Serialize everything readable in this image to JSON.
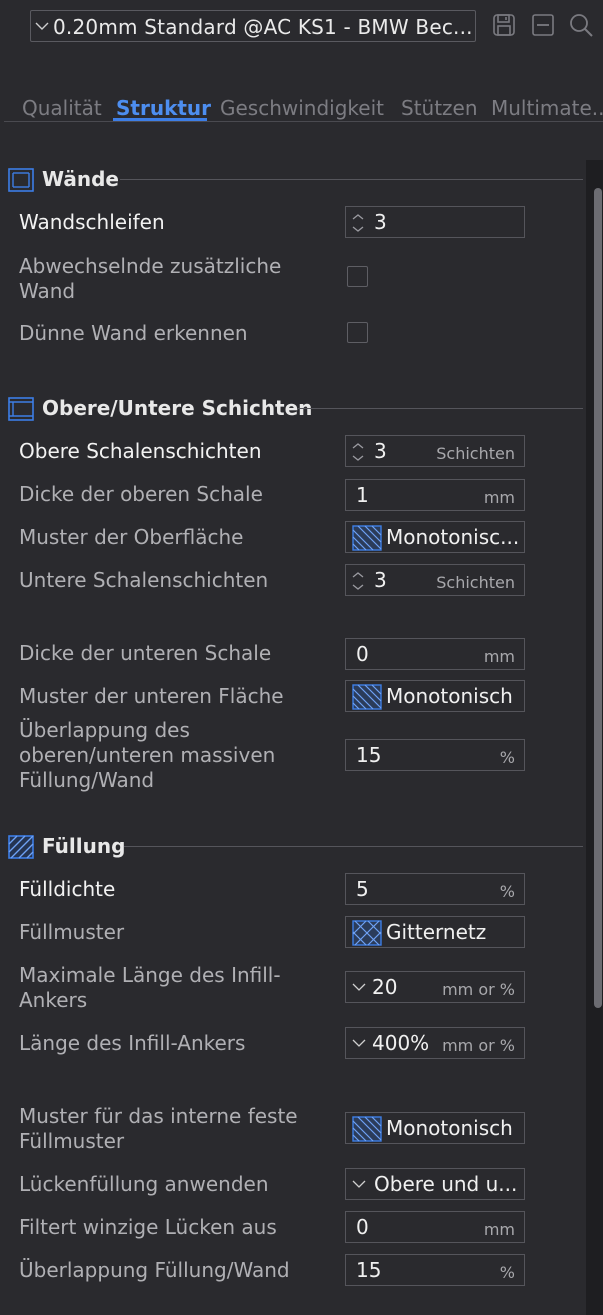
{
  "topbar": {
    "preset_label": "0.20mm Standard @AC KS1 - BMW Bec...",
    "icons": [
      "save-icon",
      "minus-box-icon",
      "search-icon"
    ]
  },
  "tabs": [
    "Qualität",
    "Struktur",
    "Geschwindigkeit",
    "Stützen",
    "Multimate.."
  ],
  "active_tab": "Struktur",
  "accent_color": "#3d7ee6",
  "sections": {
    "walls": {
      "title": "Wände",
      "rows": {
        "wall_loops": {
          "label": "Wandschleifen",
          "value": "3"
        },
        "alt_extra_wall": {
          "label": "Abwechselnde zusätzliche Wand",
          "checked": false
        },
        "detect_thin_wall": {
          "label": "Dünne Wand erkennen",
          "checked": false
        }
      }
    },
    "top_bottom": {
      "title": "Obere/Untere Schichten",
      "rows": {
        "top_shell_layers": {
          "label": "Obere Schalenschichten",
          "value": "3",
          "unit": "Schichten"
        },
        "top_shell_thickness": {
          "label": "Dicke der oberen Schale",
          "value": "1",
          "unit": "mm"
        },
        "top_surface_pattern": {
          "label": "Muster der Oberfläche",
          "value": "Monotonisc..."
        },
        "bottom_shell_layers": {
          "label": "Untere Schalenschichten",
          "value": "3",
          "unit": "Schichten"
        },
        "bottom_shell_thickness": {
          "label": "Dicke der unteren Schale",
          "value": "0",
          "unit": "mm"
        },
        "bottom_surface_pattern": {
          "label": "Muster der unteren Fläche",
          "value": "Monotonisch"
        },
        "overlap": {
          "label": "Überlappung des oberen/unteren massiven Füllung/Wand",
          "value": "15",
          "unit": "%"
        }
      }
    },
    "infill": {
      "title": "Füllung",
      "rows": {
        "density": {
          "label": "Fülldichte",
          "value": "5",
          "unit": "%"
        },
        "pattern": {
          "label": "Füllmuster",
          "value": "Gitternetz"
        },
        "max_anchor": {
          "label": "Maximale Länge des Infill-Ankers",
          "value": "20",
          "unit": "mm or %"
        },
        "anchor_len": {
          "label": "Länge des Infill-Ankers",
          "value": "400%",
          "unit": "mm or %"
        },
        "internal_solid_pattern": {
          "label": "Muster für das interne feste Füllmuster",
          "value": "Monotonisch"
        },
        "gap_fill": {
          "label": "Lückenfüllung anwenden",
          "value": "Obere und u..."
        },
        "filter_gaps": {
          "label": "Filtert winzige Lücken aus",
          "value": "0",
          "unit": "mm"
        },
        "infill_wall_overlap": {
          "label": "Überlappung Füllung/Wand",
          "value": "15",
          "unit": "%"
        }
      }
    }
  }
}
